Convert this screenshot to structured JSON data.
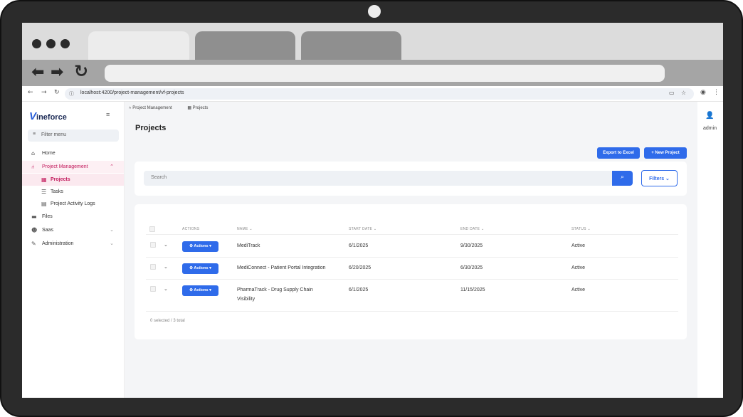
{
  "browser": {
    "url": "localhost:4200/project-management/vf-projects"
  },
  "sidebar": {
    "logo_mark": "V",
    "logo_text": "ineforce",
    "filter_placeholder": "Filter menu",
    "items": [
      {
        "label": "Home",
        "icon": "home-icon"
      },
      {
        "label": "Project Management",
        "icon": "sitemap-icon"
      },
      {
        "label": "Projects",
        "icon": "table-icon"
      },
      {
        "label": "Tasks",
        "icon": "list-icon"
      },
      {
        "label": "Project Activity Logs",
        "icon": "file-icon"
      },
      {
        "label": "Files",
        "icon": "folder-icon"
      },
      {
        "label": "Saas",
        "icon": "users-icon"
      },
      {
        "label": "Administration",
        "icon": "wrench-icon"
      }
    ]
  },
  "breadcrumb": [
    "Project Management",
    "Projects"
  ],
  "page": {
    "title": "Projects",
    "export_label": "Export to Excel",
    "new_label": "New Project",
    "search_placeholder": "Search",
    "filters_label": "Filters"
  },
  "table": {
    "headers": [
      "ACTIONS",
      "NAME",
      "START DATE",
      "END DATE",
      "STATUS"
    ],
    "action_label": "Actions",
    "rows": [
      {
        "name": "MediTrack",
        "start": "6/1/2025",
        "end": "9/30/2025",
        "status": "Active"
      },
      {
        "name": "MediConnect - Patient Portal Integration",
        "start": "6/20/2025",
        "end": "6/30/2025",
        "status": "Active"
      },
      {
        "name": "PharmaTrack - Drug Supply Chain Visibility",
        "start": "6/1/2025",
        "end": "11/15/2025",
        "status": "Active"
      }
    ],
    "footer": "0 selected / 3 total"
  },
  "user": {
    "name": "admin"
  },
  "colors": {
    "primary": "#2f6bea",
    "active": "#c2185b"
  }
}
